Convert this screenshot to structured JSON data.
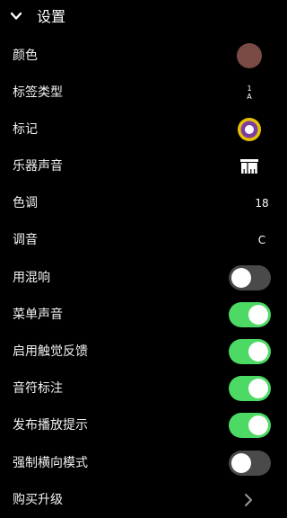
{
  "header": {
    "title": "设置"
  },
  "colors": {
    "background": "#000000",
    "toggle_on": "#4cd964",
    "toggle_off": "#4a4a4a",
    "swatch": "#7a4a44",
    "marker_outer": "#e6c200",
    "marker_inner": "#7a3fa0"
  },
  "settings": [
    {
      "label": "颜色",
      "control": "color-swatch",
      "swatch_color": "#7a4a44"
    },
    {
      "label": "标签类型",
      "control": "label-type",
      "value_top": "1",
      "value_bottom": "A"
    },
    {
      "label": "标记",
      "control": "marker-icon",
      "icon": "target-ring-icon"
    },
    {
      "label": "乐器声音",
      "control": "instrument-icon",
      "icon": "piano-keys-icon"
    },
    {
      "label": "色调",
      "control": "text",
      "value": "18"
    },
    {
      "label": "调音",
      "control": "text",
      "value": "C"
    },
    {
      "label": "用混响",
      "control": "toggle",
      "on": false
    },
    {
      "label": "菜单声音",
      "control": "toggle",
      "on": true
    },
    {
      "label": "启用触觉反馈",
      "control": "toggle",
      "on": true
    },
    {
      "label": "音符标注",
      "control": "toggle",
      "on": true
    },
    {
      "label": "发布播放提示",
      "control": "toggle",
      "on": true
    },
    {
      "label": "强制横向模式",
      "control": "toggle",
      "on": false
    },
    {
      "label": "购买升级",
      "control": "chevron",
      "icon": "chevron-right-icon"
    }
  ]
}
